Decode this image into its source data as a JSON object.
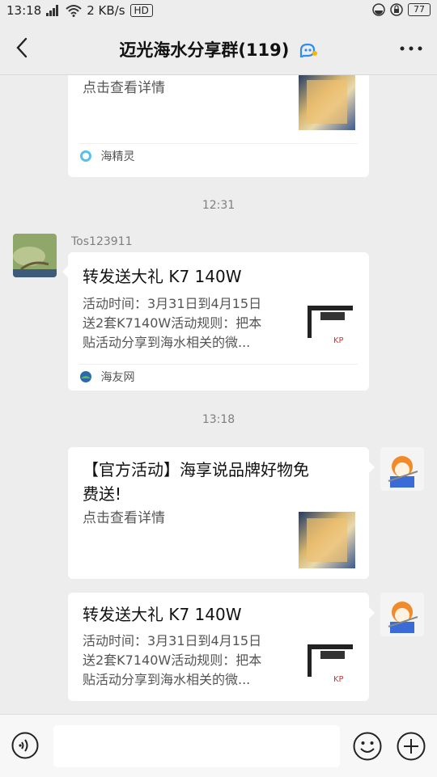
{
  "status_bar": {
    "time": "13:18",
    "network_speed": "2 KB/s",
    "hd_label": "HD",
    "battery": "77"
  },
  "header": {
    "title": "迈光海水分享群(119)"
  },
  "messages": {
    "card1": {
      "detail": "点击查看详情",
      "source": "海精灵"
    },
    "time1": "12:31",
    "msg2": {
      "sender": "Tos123911",
      "title": "转发送大礼 K7 140W",
      "desc_line1": "活动时间：3月31日到4月15日",
      "desc_line2": "送2套K7140W活动规则：把本",
      "desc_line3": "贴活动分享到海水相关的微...",
      "source": "海友网"
    },
    "time2": "13:18",
    "msg3": {
      "title_line1": "【官方活动】海享说品牌好物免",
      "title_line2": "费送!",
      "detail": "点击查看详情"
    },
    "msg4": {
      "title": "转发送大礼 K7 140W",
      "desc_line1": "活动时间：3月31日到4月15日",
      "desc_line2": "送2套K7140W活动规则：把本",
      "desc_line3": "贴活动分享到海水相关的微..."
    }
  },
  "colors": {
    "background": "#ededed",
    "card": "#ffffff",
    "muted_text": "#7f7f7f"
  },
  "icons": [
    "back-icon",
    "group-tag-icon",
    "more-icon",
    "voice-icon",
    "emoji-icon",
    "plus-icon",
    "app-source-icon",
    "site-source-icon"
  ]
}
